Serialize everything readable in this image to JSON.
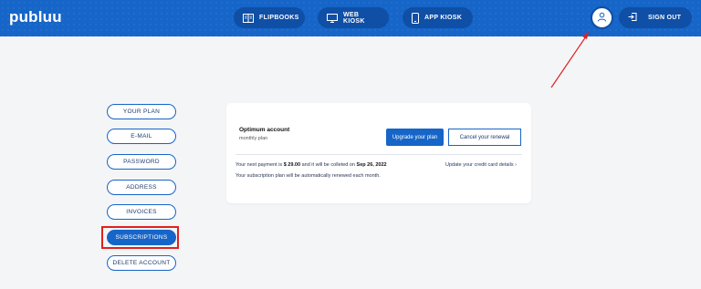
{
  "header": {
    "logo": "publuu",
    "nav": [
      {
        "label": "FLIPBOOKS",
        "icon": "book-open-icon"
      },
      {
        "label": "WEB KIOSK",
        "icon": "monitor-icon"
      },
      {
        "label": "APP KIOSK",
        "icon": "smartphone-icon"
      }
    ],
    "account_icon": "user-icon",
    "signout": {
      "label": "SIGN OUT",
      "icon": "sign-out-icon"
    }
  },
  "sidebar": {
    "items": [
      {
        "label": "YOUR PLAN"
      },
      {
        "label": "E-MAIL"
      },
      {
        "label": "PASSWORD"
      },
      {
        "label": "ADDRESS"
      },
      {
        "label": "INVOICES"
      },
      {
        "label": "SUBSCRIPTIONS",
        "active": true
      },
      {
        "label": "DELETE ACCOUNT"
      }
    ]
  },
  "subscription": {
    "plan_name": "Optimum account",
    "plan_period": "monthly plan",
    "upgrade_label": "Upgrade your plan",
    "cancel_label": "Cancel your renewal",
    "payment_prefix": "Your next payment is",
    "payment_amount": "$ 29.00",
    "payment_middle": "and it will be colleted on",
    "payment_date": "Sep 26, 2022",
    "renewal_note": "Your subscription plan will be automatically renewed each month.",
    "update_card_label": "Update your credit card details"
  },
  "colors": {
    "brand": "#1665c8",
    "annotation": "#e02020"
  }
}
